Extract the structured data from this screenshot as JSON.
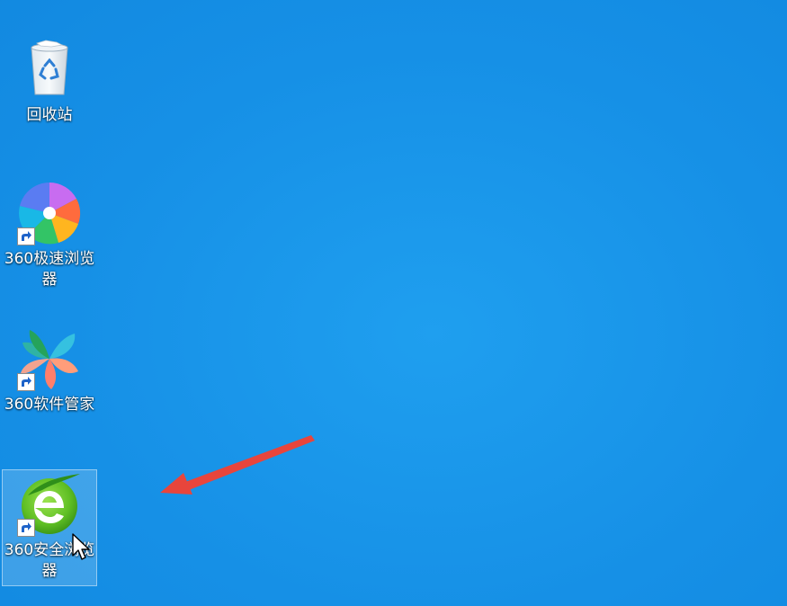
{
  "desktop": {
    "icons": [
      {
        "label": "回收站",
        "icon": "recycle-bin-icon",
        "shortcut": false,
        "selected": false
      },
      {
        "label": "360极速浏览器",
        "icon": "360-speed-browser-icon",
        "shortcut": true,
        "selected": false
      },
      {
        "label": "360软件管家",
        "icon": "360-software-manager-icon",
        "shortcut": true,
        "selected": false
      },
      {
        "label": "360安全浏览器",
        "icon": "360-secure-browser-icon",
        "shortcut": true,
        "selected": true
      }
    ],
    "annotation": {
      "type": "arrow",
      "color": "#e8453c"
    },
    "cursor": "mouse-pointer-icon",
    "colors": {
      "background": "#1690e6",
      "label_text": "#ffffff",
      "selection": "#ffffff"
    }
  }
}
